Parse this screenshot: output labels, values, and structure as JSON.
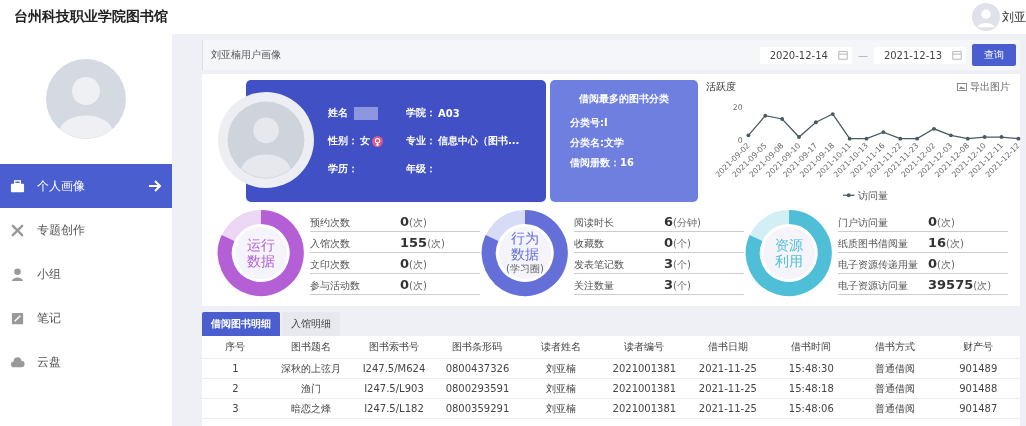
{
  "header": {
    "title": "台州科技职业学院图书馆",
    "user_name": "刘亚"
  },
  "sidebar": {
    "items": [
      {
        "label": "个人画像",
        "selected": true
      },
      {
        "label": "专题创作",
        "selected": false
      },
      {
        "label": "小组",
        "selected": false
      },
      {
        "label": "笔记",
        "selected": false
      },
      {
        "label": "云盘",
        "selected": false
      }
    ]
  },
  "panel": {
    "title": "刘亚楠用户画像",
    "start_date": "2020-12-14",
    "separator": "—",
    "end_date": "2021-12-13",
    "query_button": "查询"
  },
  "profile": {
    "fields": [
      {
        "label": "姓名",
        "kind": "redacted"
      },
      {
        "label": "学院：",
        "kind": "text",
        "value": "A03"
      },
      {
        "label": "性别：",
        "kind": "gender",
        "value": "女"
      },
      {
        "label": "专业：",
        "kind": "text",
        "value": "信息中心（图书..."
      },
      {
        "label": "学历：",
        "kind": "text"
      },
      {
        "label": "年级：",
        "kind": "text"
      }
    ]
  },
  "category_card": {
    "title": "借阅最多的图书分类",
    "lines": [
      "分类号:I",
      "分类名:文学",
      "借阅册数：16"
    ]
  },
  "activity": {
    "title": "活跃度",
    "export": "导出图片",
    "chart_data": {
      "type": "line",
      "x": [
        "2021-09-02",
        "2021-09-05",
        "2021-09-08",
        "2021-09-10",
        "2021-09-17",
        "2021-09-18",
        "2021-10-11",
        "2021-10-13",
        "2021-11-16",
        "2021-11-22",
        "2021-11-23",
        "2021-12-02",
        "2021-12-03",
        "2021-12-08",
        "2021-12-10",
        "2021-12-11",
        "2021-12-12"
      ],
      "yticks": [
        0,
        20
      ],
      "ylim": [
        0,
        20
      ],
      "series": [
        {
          "name": "访问量",
          "color": "#4a5a60",
          "values": [
            3,
            15,
            13,
            2,
            11,
            16,
            1,
            1,
            5,
            1,
            1,
            7,
            3,
            1,
            2,
            2,
            1
          ]
        }
      ]
    }
  },
  "stat_groups": [
    {
      "title": [
        "运行",
        "数据"
      ],
      "color": "#b55fd6",
      "stats": [
        {
          "label": "预约次数",
          "value": "0",
          "unit": "(次)"
        },
        {
          "label": "入馆次数",
          "value": "155",
          "unit": "(次)"
        },
        {
          "label": "文印次数",
          "value": "0",
          "unit": "(次)"
        },
        {
          "label": "参与活动数",
          "value": "0",
          "unit": "(次)"
        }
      ]
    },
    {
      "title": [
        "行为",
        "数据"
      ],
      "subtitle": "(学习圈)",
      "color": "#6470d8",
      "stats": [
        {
          "label": "阅读时长",
          "value": "6",
          "unit": "(分钟)"
        },
        {
          "label": "收藏数",
          "value": "0",
          "unit": "(个)"
        },
        {
          "label": "发表笔记数",
          "value": "3",
          "unit": "(个)"
        },
        {
          "label": "关注数量",
          "value": "3",
          "unit": "(个)"
        }
      ]
    },
    {
      "title": [
        "资源",
        "利用"
      ],
      "color": "#4fbfd8",
      "stats": [
        {
          "label": "门户访问量",
          "value": "0",
          "unit": "(次)"
        },
        {
          "label": "纸质图书借阅量",
          "value": "16",
          "unit": "(次)"
        },
        {
          "label": "电子资源传递用量",
          "value": "0",
          "unit": "(次)"
        },
        {
          "label": "电子资源访问量",
          "value": "39575",
          "unit": "(次)"
        }
      ]
    }
  ],
  "tabs": [
    {
      "label": "借阅图书明细",
      "selected": true
    },
    {
      "label": "入馆明细",
      "selected": false
    }
  ],
  "table": {
    "columns": [
      "序号",
      "图书题名",
      "图书索书号",
      "图书条形码",
      "读者姓名",
      "读者编号",
      "借书日期",
      "借书时间",
      "借书方式",
      "财产号"
    ],
    "rows": [
      [
        "1",
        "深秋的上弦月",
        "I247.5/M624",
        "0800437326",
        "刘亚楠",
        "2021001381",
        "2021-11-25",
        "15:48:30",
        "普通借阅",
        "901489"
      ],
      [
        "2",
        "渔门",
        "I247.5/L903",
        "0800293591",
        "刘亚楠",
        "2021001381",
        "2021-11-25",
        "15:48:18",
        "普通借阅",
        "901488"
      ],
      [
        "3",
        "暗恋之烽",
        "I247.5/L182",
        "0800359291",
        "刘亚楠",
        "2021001381",
        "2021-11-25",
        "15:48:06",
        "普通借阅",
        "901487"
      ]
    ]
  }
}
